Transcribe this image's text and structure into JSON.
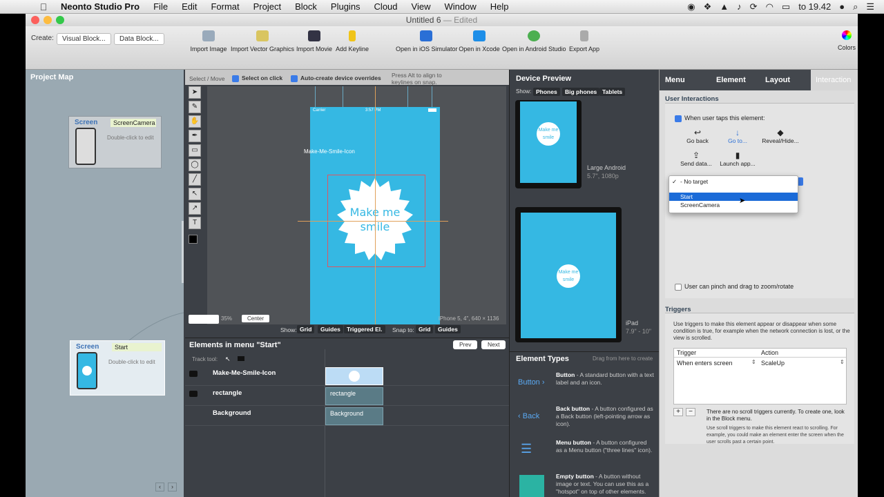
{
  "menubar": {
    "items": [
      "Neonto Studio Pro",
      "File",
      "Edit",
      "Format",
      "Project",
      "Block",
      "Plugins",
      "Cloud",
      "View",
      "Window",
      "Help"
    ],
    "clock": "to 19.42"
  },
  "window": {
    "title": "Untitled 6",
    "title_status": "— Edited"
  },
  "toolbar": {
    "create_label": "Create:",
    "visual_block": "Visual Block...",
    "data_block": "Data Block...",
    "items": [
      "Import Image",
      "Import Vector Graphics",
      "Import Movie",
      "Add Keyline",
      "Open in iOS Simulator",
      "Open in Xcode",
      "Open in Android Studio",
      "Export App",
      "Colors"
    ]
  },
  "project_map": {
    "title": "Project Map",
    "cards": [
      {
        "title": "Screen",
        "name": "ScreenCamera",
        "desc": "Double-click to edit"
      },
      {
        "title": "Screen",
        "name": "Start",
        "desc": "Double-click to edit"
      }
    ]
  },
  "editor": {
    "select_move": "Select / Move",
    "select_on_click": "Select on click",
    "auto_create": "Auto-create device overrides",
    "hint": "Press Alt to align to keylines on snap.",
    "element_label": "Make-Me-Smile-Icon",
    "badge_text": "Make me smile",
    "status_carrier": "Carrier",
    "status_time": "3:57 PM",
    "zoom": "35%",
    "center_btn": "Center",
    "device_info": "iPhone 5, 4\", 640 × 1136",
    "show_label": "Show:",
    "show_opts": [
      "Grid",
      "Guides",
      "Triggered El."
    ],
    "snap_label": "Snap to:",
    "snap_opts": [
      "Grid",
      "Guides"
    ]
  },
  "elements": {
    "title": "Elements in menu \"Start\"",
    "prev": "Prev",
    "next": "Next",
    "track_tool": "Track tool:",
    "rows": [
      {
        "name": "Make-Me-Smile-Icon",
        "track": ""
      },
      {
        "name": "rectangle",
        "track": "rectangle"
      },
      {
        "name": "Background",
        "track": "Background"
      }
    ]
  },
  "device_preview": {
    "title": "Device Preview",
    "show_label": "Show:",
    "filters": [
      "Phones",
      "Big phones",
      "Tablets"
    ],
    "devices": [
      {
        "name": "Large Android",
        "spec": "5.7\", 1080p",
        "badge": "Make me smile"
      },
      {
        "name": "iPad",
        "spec": "7.9\" - 10\"",
        "badge": "Make me smile"
      }
    ]
  },
  "element_types": {
    "title": "Element Types",
    "hint": "Drag from here to create",
    "items": [
      {
        "icon_label": "Button",
        "name": "Button",
        "desc": " - A standard button with a text label and an icon."
      },
      {
        "icon_label": "Back",
        "name": "Back button",
        "desc": " - A button configured as a Back button (left-pointing arrow as icon)."
      },
      {
        "icon_label": "",
        "name": "Menu button",
        "desc": " - A button configured as a Menu button (\"three lines\" icon)."
      },
      {
        "icon_label": "",
        "name": "Empty button",
        "desc": " - A button without image or text. You can use this as a \"hotspot\" on top of other elements."
      }
    ]
  },
  "inspector": {
    "tabs": [
      "Menu",
      "Element",
      "Layout",
      "Interaction"
    ],
    "user_interactions": "User Interactions",
    "when_taps": "When user taps this element:",
    "actions": [
      "Go back",
      "Go to...",
      "Reveal/Hide...",
      "Send data...",
      "Launch app..."
    ],
    "dropdown": [
      "No target",
      "Start",
      "ScreenCamera"
    ],
    "pinch": "User can pinch and drag to zoom/rotate",
    "triggers_title": "Triggers",
    "triggers_desc": "Use triggers to make this element appear or disappear when some condition is true, for example when the network connection is lost, or the view is scrolled.",
    "table_headers": [
      "Trigger",
      "Action"
    ],
    "table_row": [
      "When enters screen",
      "ScaleUp"
    ],
    "no_scroll": "There are no scroll triggers currently. To create one, look in the Block menu.",
    "scroll_desc": "Use scroll triggers to make this element react to scrolling. For example, you could make an element enter the screen when the user scrolls past a certain point."
  },
  "colors": {
    "accent": "#35b8e3",
    "selection": "#1b6bd8"
  }
}
